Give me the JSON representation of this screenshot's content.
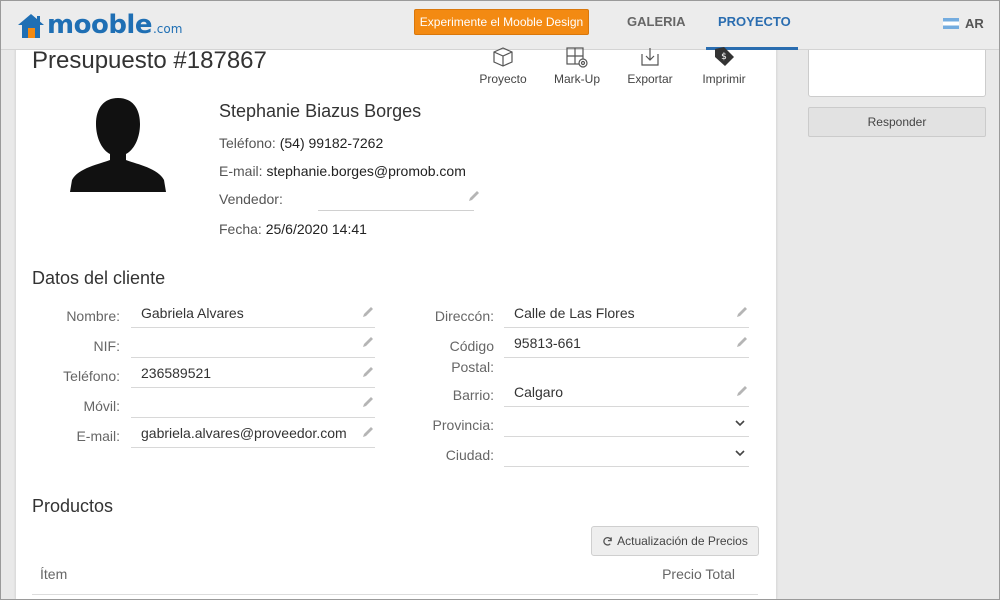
{
  "header": {
    "logo_text": "mooble",
    "logo_suffix": ".com",
    "cta_label": "Experimente el Mooble Design",
    "nav": [
      {
        "label": "GALERIA"
      },
      {
        "label": "PROYECTO"
      }
    ],
    "language": "AR"
  },
  "budget": {
    "title": "Presupuesto #187867",
    "tools": [
      {
        "label": "Proyecto",
        "icon": "project-icon"
      },
      {
        "label": "Mark-Up",
        "icon": "markup-icon"
      },
      {
        "label": "Exportar",
        "icon": "export-icon"
      },
      {
        "label": "Imprimir",
        "icon": "print-tag-icon"
      }
    ]
  },
  "contact": {
    "name": "Stephanie Biazus Borges",
    "phone_label": "Teléfono:",
    "phone": "(54) 99182-7262",
    "email_label": "E-mail:",
    "email": "stephanie.borges@promob.com",
    "seller_label": "Vendedor:",
    "seller": "",
    "date_label": "Fecha:",
    "date": "25/6/2020 14:41"
  },
  "client": {
    "section_title": "Datos del cliente",
    "left_fields": [
      {
        "label": "Nombre:",
        "value": "Gabriela Alvares"
      },
      {
        "label": "NIF:",
        "value": ""
      },
      {
        "label": "Teléfono:",
        "value": "236589521"
      },
      {
        "label": "Móvil:",
        "value": ""
      },
      {
        "label": "E-mail:",
        "value": "gabriela.alvares@proveedor.com"
      }
    ],
    "right_fields": [
      {
        "label": "Direccón:",
        "value": "Calle de Las Flores"
      },
      {
        "label": "Código",
        "label2": "Postal:",
        "value": "95813-661"
      },
      {
        "label": "Barrio:",
        "value": "Calgaro"
      },
      {
        "label": "Provincia:",
        "value": ""
      },
      {
        "label": "Ciudad:",
        "value": ""
      }
    ]
  },
  "products": {
    "section_title": "Productos",
    "refresh_label": "Actualización de Precios",
    "col_item": "Ítem",
    "col_total": "Precio Total"
  },
  "sidebar": {
    "reply_value": "",
    "reply_button": "Responder"
  },
  "colors": {
    "brand": "#1f6fb4",
    "cta": "#f38a12",
    "nav_active": "#2a6db0"
  }
}
